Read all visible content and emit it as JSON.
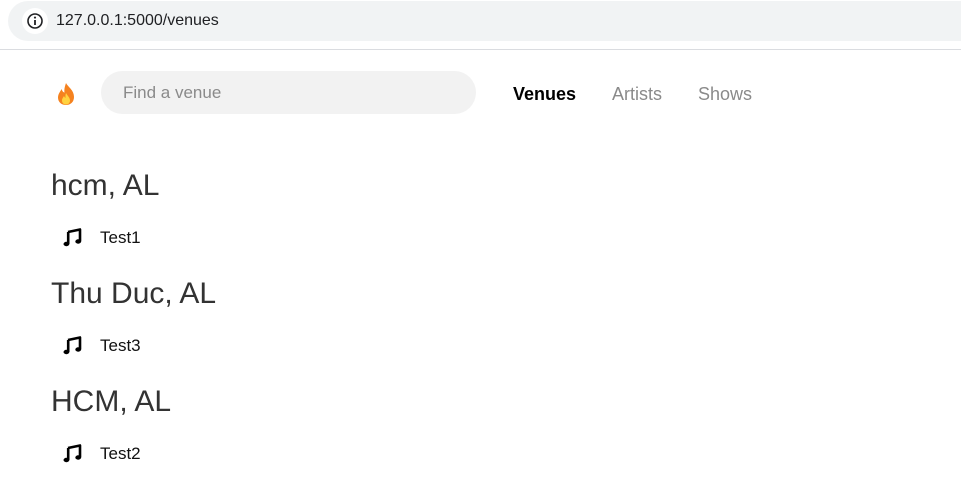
{
  "browser": {
    "url": "127.0.0.1:5000/venues"
  },
  "search": {
    "placeholder": "Find a venue"
  },
  "nav": {
    "venues": "Venues",
    "artists": "Artists",
    "shows": "Shows"
  },
  "cities": [
    {
      "title": "hcm, AL",
      "venues": [
        {
          "name": "Test1"
        }
      ]
    },
    {
      "title": "Thu Duc, AL",
      "venues": [
        {
          "name": "Test3"
        }
      ]
    },
    {
      "title": "HCM, AL",
      "venues": [
        {
          "name": "Test2"
        }
      ]
    }
  ],
  "icons": {
    "site_info": "info-icon",
    "logo": "flame-icon",
    "venue": "music-note-icon"
  },
  "colors": {
    "flame_outer": "#f5821f",
    "flame_inner": "#ffd23f"
  }
}
